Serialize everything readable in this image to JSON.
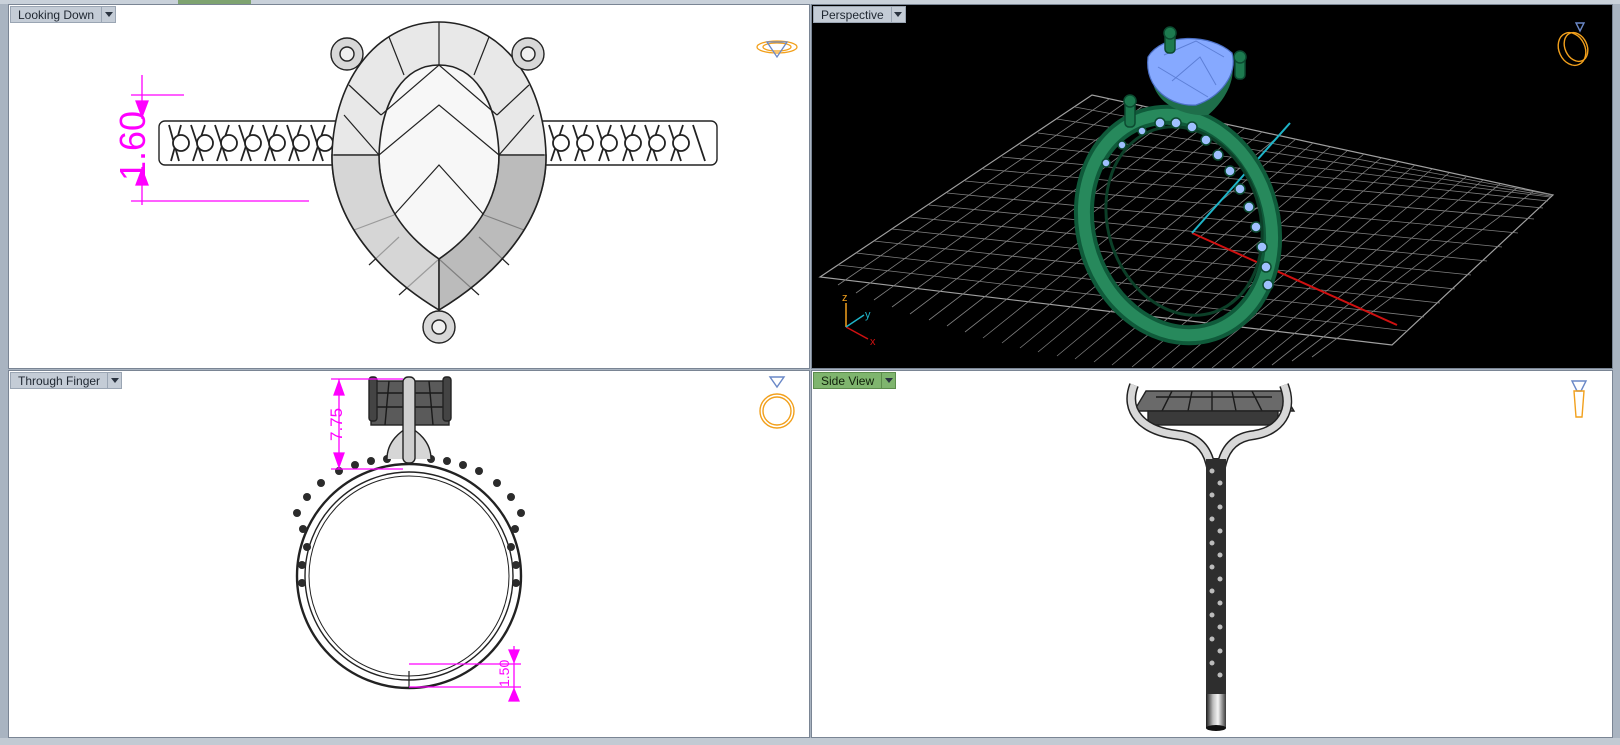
{
  "viewports": {
    "top_left": {
      "label": "Looking Down",
      "dimension": "1.60"
    },
    "top_right": {
      "label": "Perspective",
      "axes": {
        "z": "z",
        "y": "y",
        "x": "x"
      }
    },
    "bottom_left": {
      "label": "Through Finger",
      "dimension_top": "7.75",
      "dimension_bottom": "1.50"
    },
    "bottom_right": {
      "label": "Side View"
    }
  },
  "colors": {
    "dimension": "#ff00ff",
    "ring_green": "#1f7a52",
    "gem_blue": "#7fa6ff",
    "grid": "#8a8a8a",
    "axis_x": "#d01010",
    "axis_y": "#1eb4c8",
    "active_tab": "#7fb56e",
    "nav_icon": "#f2a01c"
  },
  "icons": [
    "dropdown-arrow-icon",
    "view-cube-icon"
  ]
}
